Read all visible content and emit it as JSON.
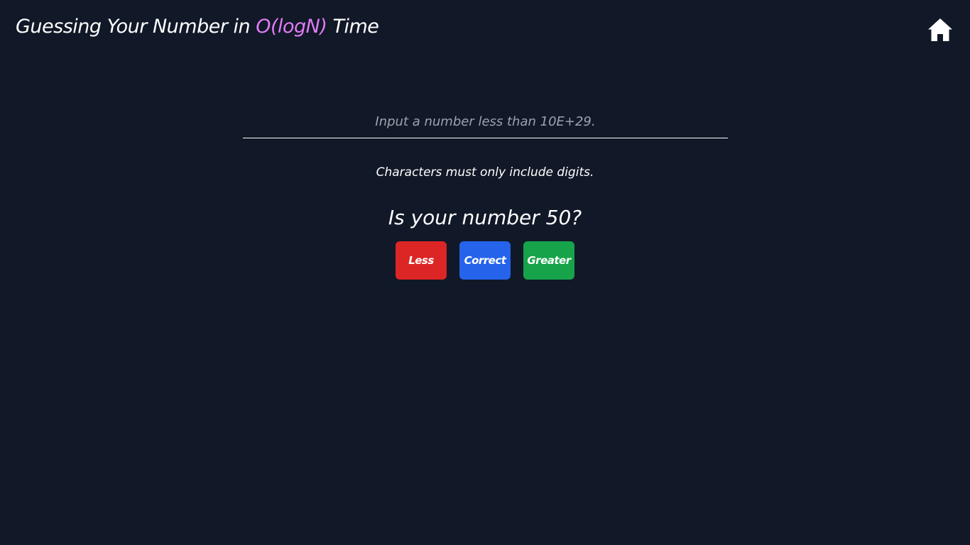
{
  "header": {
    "title_prefix": "Guessing Your Number in ",
    "title_accent": "O(logN)",
    "title_suffix": " Time",
    "home_icon": "home-icon"
  },
  "colors": {
    "background": "#111827",
    "accent": "#e17cf5",
    "less": "#dc2626",
    "correct": "#2563eb",
    "greater": "#16a34a"
  },
  "input": {
    "placeholder": "Input a number less than 10E+29.",
    "value": ""
  },
  "helper_text": "Characters must only include digits.",
  "question": "Is your number 50?",
  "buttons": {
    "less": "Less",
    "correct": "Correct",
    "greater": "Greater"
  }
}
